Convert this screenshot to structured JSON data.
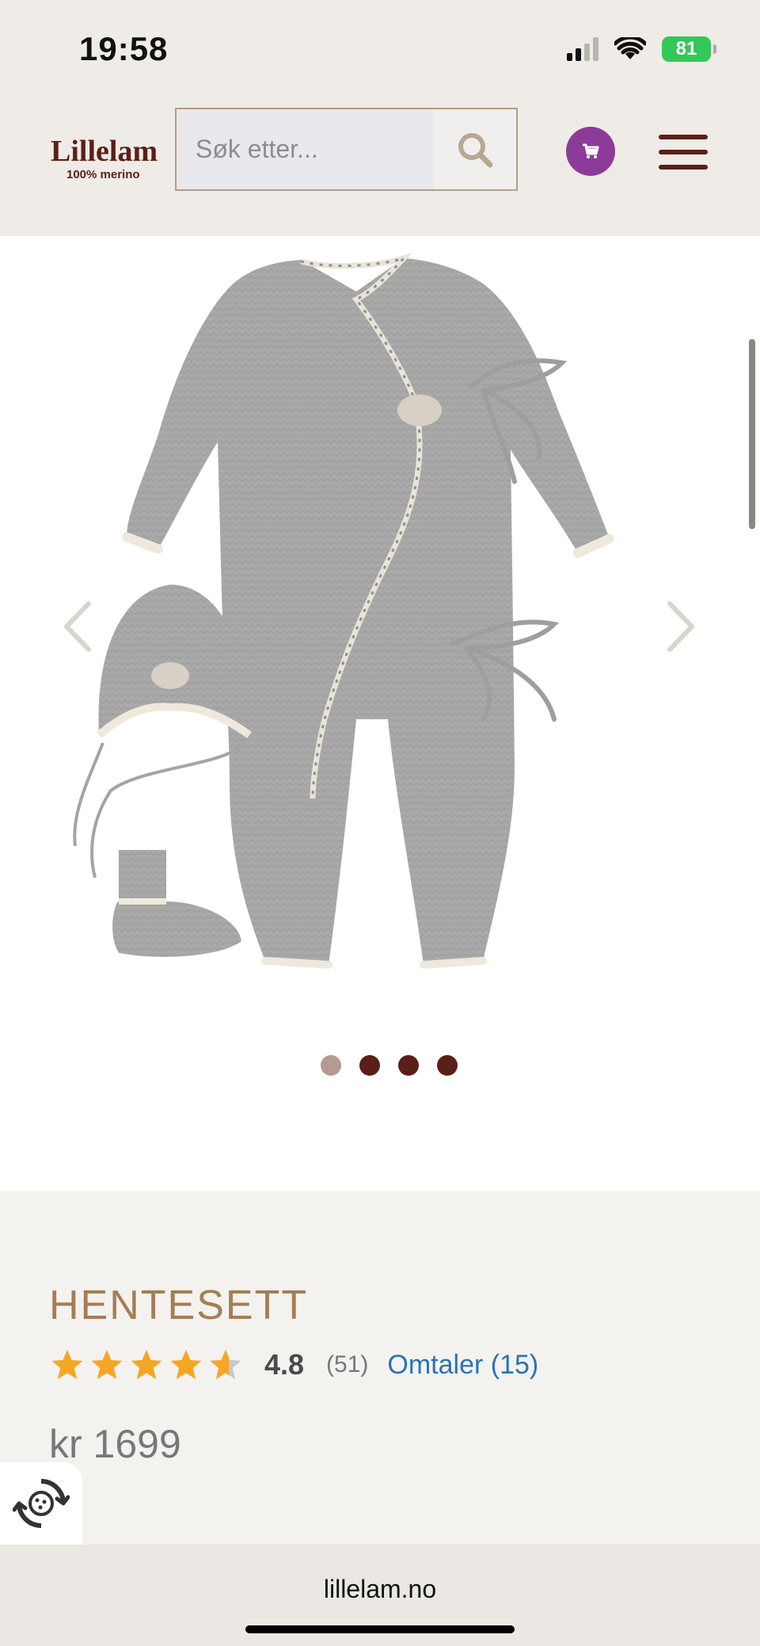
{
  "status": {
    "time": "19:58",
    "battery": "81"
  },
  "header": {
    "logo_name": "Lillelam",
    "logo_tagline": "100% merino",
    "search_placeholder": "Søk etter..."
  },
  "gallery": {
    "slide_count": 4,
    "active_index": 0
  },
  "product": {
    "title": "HENTESETT",
    "rating": "4.8",
    "rating_fraction": 0.96,
    "rating_count": "(51)",
    "reviews_link": "Omtaler (15)",
    "price": "kr 1699"
  },
  "browser": {
    "url": "lillelam.no"
  },
  "colors": {
    "brand": "#5b1f17",
    "title": "#a37e55",
    "cart": "#8d3b98",
    "star": "#f5a623",
    "link": "#2a73b8"
  }
}
